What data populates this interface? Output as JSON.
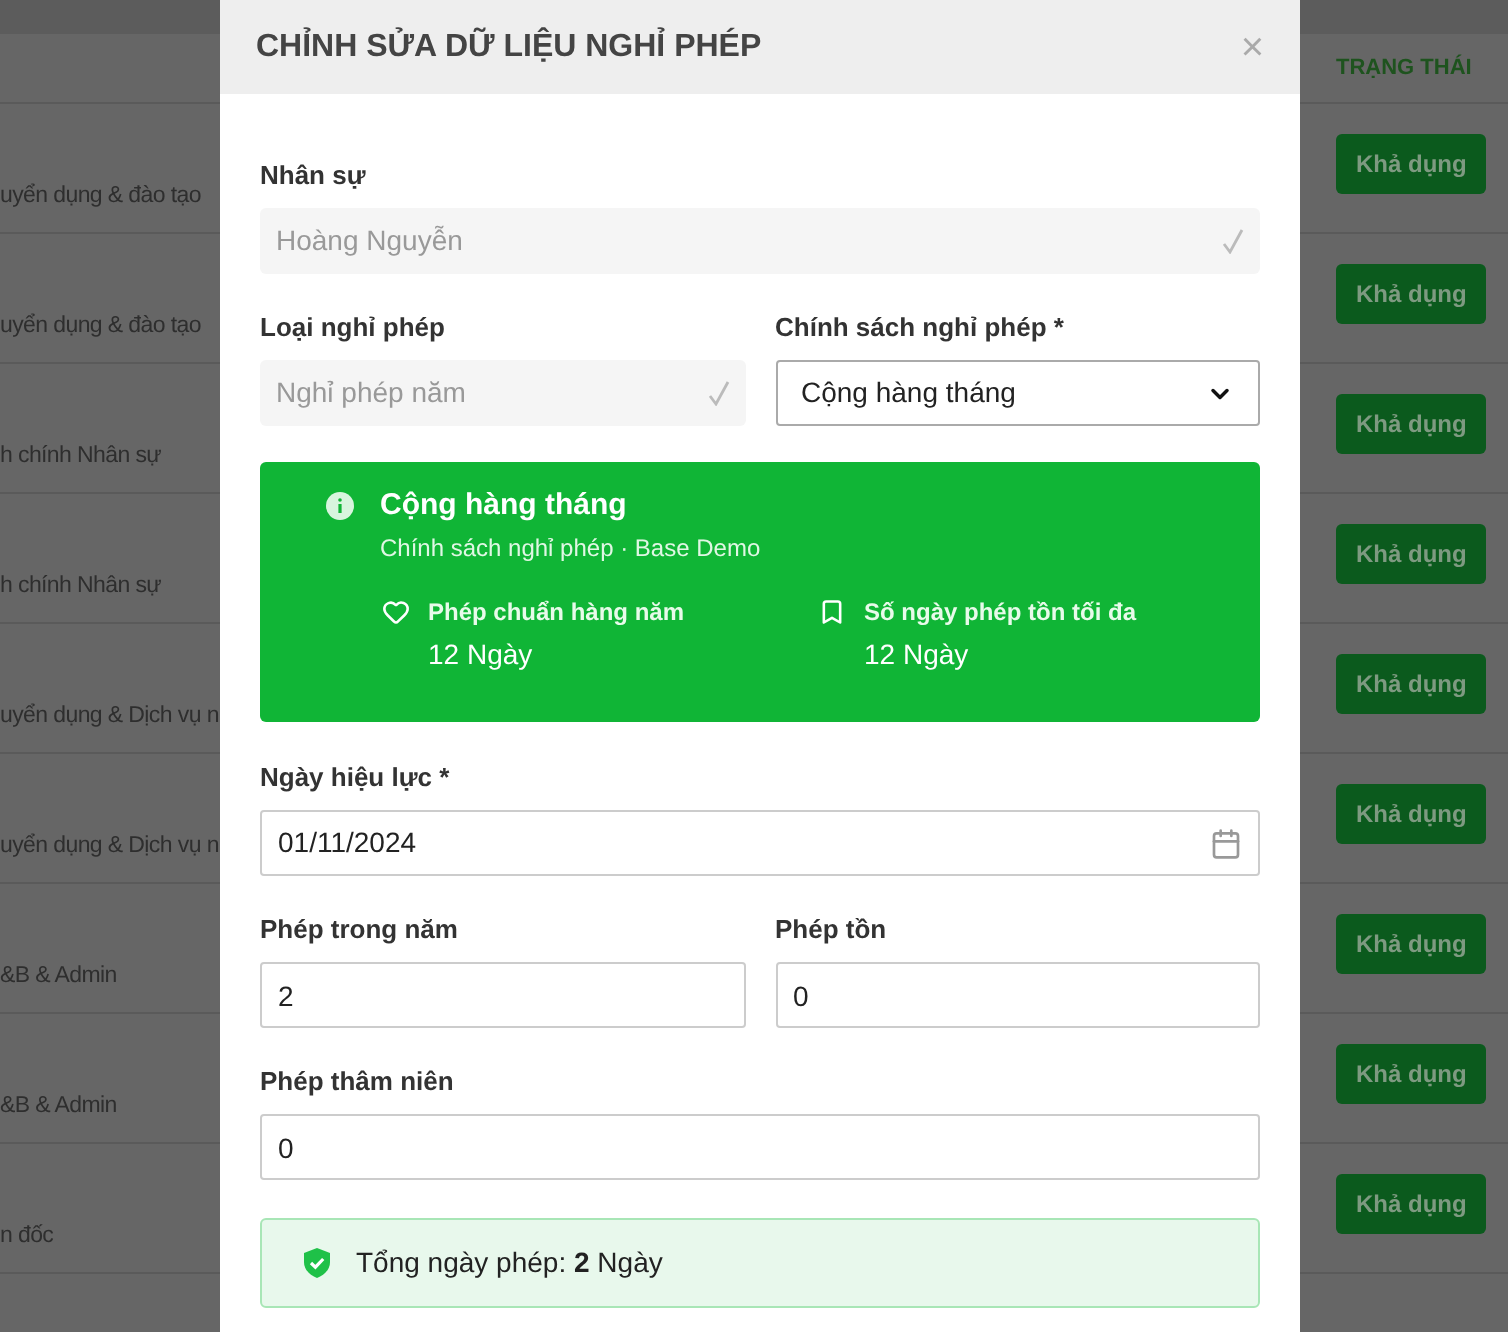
{
  "table": {
    "status_header": "TRẠNG THÁI",
    "rows": [
      {
        "column_1": "uyển dụng & đào tạo",
        "status": "Khả dụng"
      },
      {
        "column_1": "uyển dụng & đào tạo",
        "status": "Khả dụng"
      },
      {
        "column_1": "h chính Nhân sự",
        "status": "Khả dụng"
      },
      {
        "column_1": "h chính Nhân sự",
        "status": "Khả dụng"
      },
      {
        "column_1": "uyển dụng & Dịch vụ n",
        "status": "Khả dụng"
      },
      {
        "column_1": "uyển dụng & Dịch vụ n",
        "status": "Khả dụng"
      },
      {
        "column_1": "&B & Admin",
        "status": "Khả dụng"
      },
      {
        "column_1": "&B & Admin",
        "status": "Khả dụng"
      },
      {
        "column_1": "n đốc",
        "status": "Khả dụng"
      }
    ]
  },
  "modal": {
    "title": "CHỈNH SỬA DỮ LIỆU NGHỈ PHÉP",
    "close": "×",
    "employee": {
      "label": "Nhân sự",
      "value": "Hoàng Nguyễn",
      "disabled": true
    },
    "leave_type": {
      "label": "Loại nghỉ phép",
      "value": "Nghỉ phép năm",
      "disabled": true
    },
    "policy": {
      "label": "Chính sách nghỉ phép *",
      "value": "Cộng hàng tháng"
    },
    "policy_card": {
      "title": "Cộng hàng tháng",
      "subtitle": "Chính sách nghỉ phép · Base Demo",
      "stats": [
        {
          "kind": "heart",
          "label": "Phép chuẩn hàng năm",
          "value": "12 Ngày"
        },
        {
          "kind": "bookmark",
          "label": "Số ngày phép tồn tối đa",
          "value": "12 Ngày"
        }
      ]
    },
    "effective_date": {
      "label": "Ngày hiệu lực *",
      "value": "01/11/2024"
    },
    "annual_leave": {
      "label": "Phép trong năm",
      "value": "2"
    },
    "carried_leave": {
      "label": "Phép tồn",
      "value": "0"
    },
    "seniority_leave": {
      "label": "Phép thâm niên",
      "value": "0"
    },
    "summary": "Tổng ngày phép: **2** Ngày"
  }
}
